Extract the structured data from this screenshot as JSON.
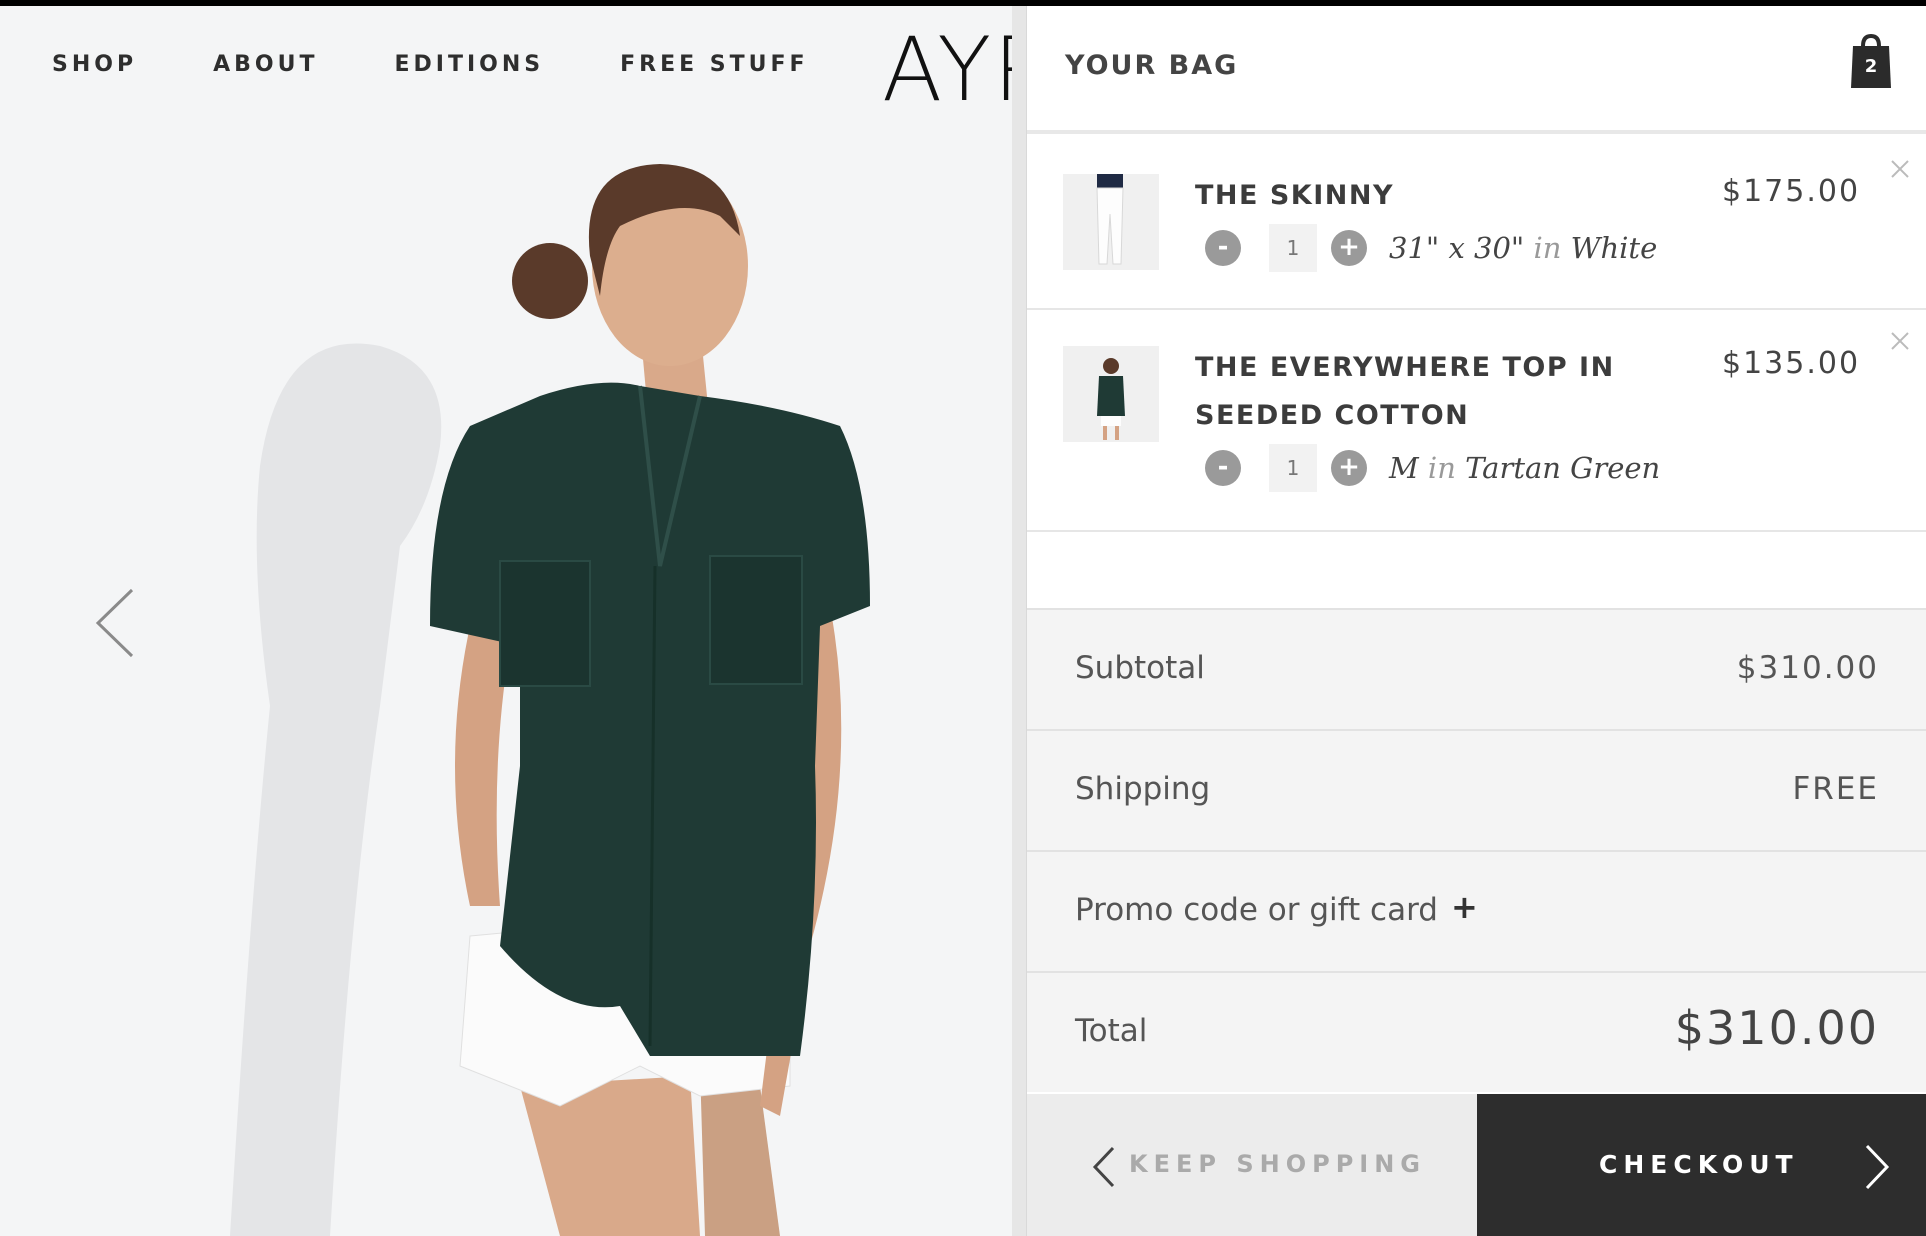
{
  "nav": {
    "items": [
      "SHOP",
      "ABOUT",
      "EDITIONS",
      "FREE STUFF"
    ],
    "logo": "AYR"
  },
  "bag": {
    "title": "YOUR BAG",
    "count": "2",
    "items": [
      {
        "name": "THE SKINNY",
        "price": "$175.00",
        "quantity": "1",
        "size": "31\" x 30\"",
        "in_word": "in",
        "color": "White"
      },
      {
        "name": "THE EVERYWHERE TOP IN SEEDED COTTON",
        "price": "$135.00",
        "quantity": "1",
        "size": "M",
        "in_word": "in",
        "color": "Tartan Green"
      }
    ],
    "subtotal_label": "Subtotal",
    "subtotal_value": "$310.00",
    "shipping_label": "Shipping",
    "shipping_value": "FREE",
    "promo_label": "Promo code or gift card",
    "promo_icon": "+",
    "total_label": "Total",
    "total_value": "$310.00",
    "qty_minus": "-",
    "qty_plus": "+",
    "keep_shopping": "KEEP SHOPPING",
    "checkout": "CHECKOUT"
  },
  "colors": {
    "shirt": "#1f3a35",
    "checkout_bg": "#2d2d2d",
    "totals_bg": "#f4f4f4"
  }
}
